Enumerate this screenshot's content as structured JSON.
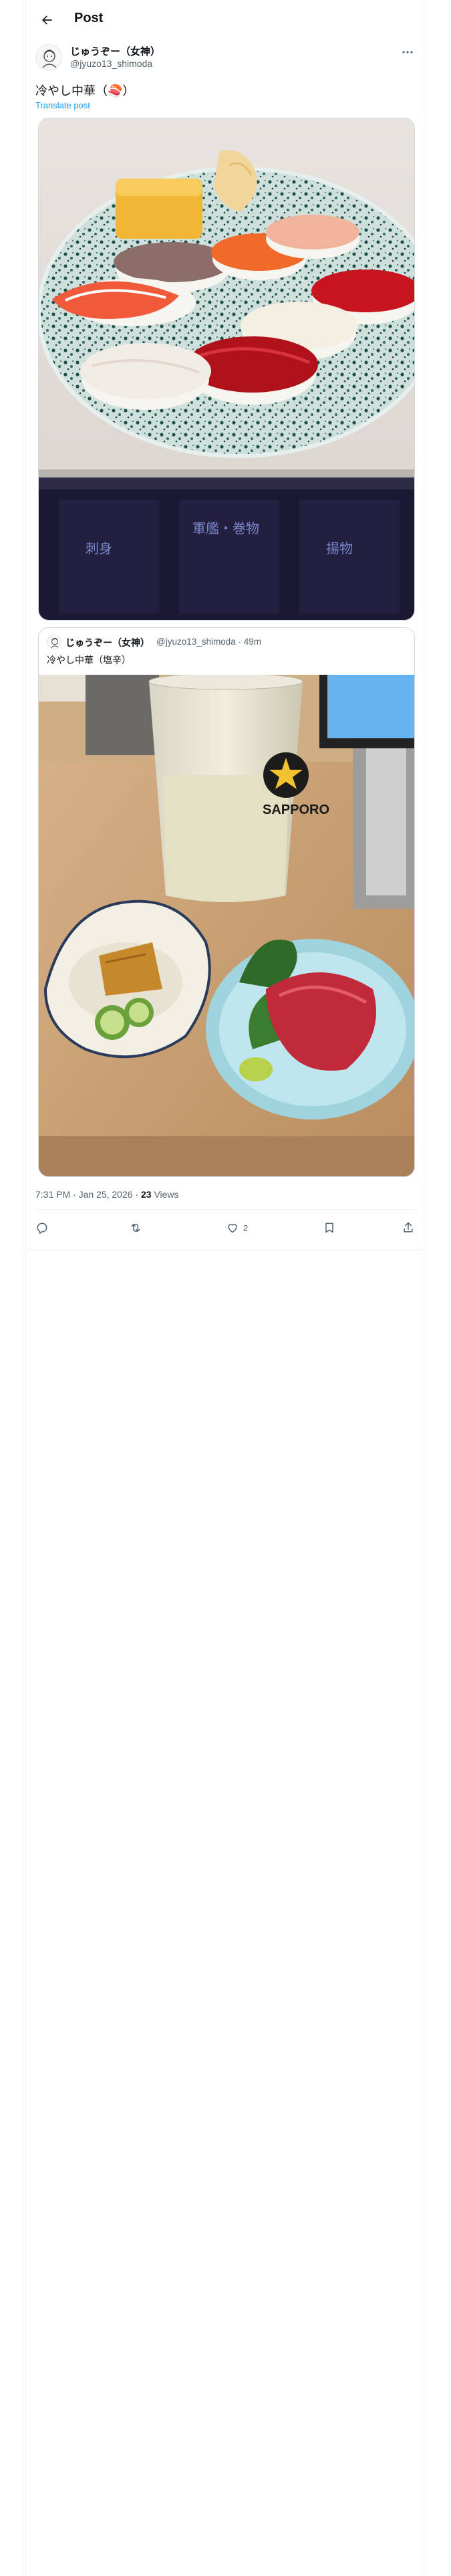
{
  "header": {
    "title": "Post"
  },
  "post": {
    "author_name": "じゅうぞー（女神）",
    "author_handle": "@jyuzo13_shimoda",
    "text": "冷やし中華（🍣）",
    "translate_label": "Translate post",
    "main_image_alt": "Plate of nigiri sushi on a speckled blue plate",
    "main_image_sign_texts": [
      "刺身",
      "軍艦・巻物",
      "揚物"
    ]
  },
  "quote": {
    "author_name": "じゅうぞー（女神）",
    "author_handle": "@jyuzo13_shimoda · 49m",
    "text": "冷やし中華（塩辛）",
    "image_alt": "Glass of highball, pickles and tuna sashimi",
    "glass_label": "SAPPORO"
  },
  "meta": {
    "time": "7:31 PM · Jan 25, 2026 · ",
    "views_count": "23",
    "views_label": " Views"
  },
  "actions": {
    "reply_count": "",
    "repost_count": "",
    "like_count": "2",
    "bookmark_count": "",
    "share_count": ""
  },
  "colors": {
    "accent": "#1d9bf0",
    "text": "#0f1419",
    "secondary": "#536471",
    "border": "#cfd9de"
  }
}
